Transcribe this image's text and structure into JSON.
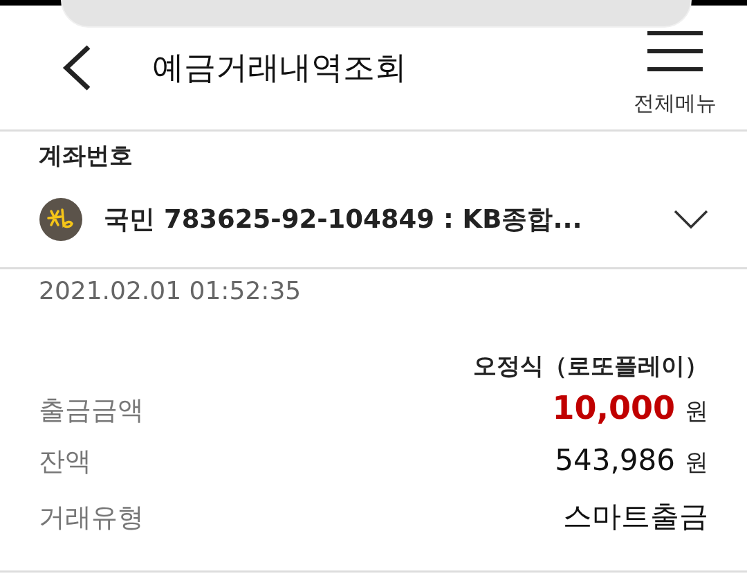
{
  "header": {
    "title": "예금거래내역조회",
    "menu_label": "전체메뉴"
  },
  "account": {
    "label": "계좌번호",
    "value": "국민 783625-92-104849 : KB종합..."
  },
  "transaction": {
    "datetime": "2021.02.01 01:52:35",
    "counterparty": "오정식（로또플레이）",
    "rows": [
      {
        "label": "출금금액",
        "value": "10,000",
        "unit": "원",
        "kind": "highlight"
      },
      {
        "label": "잔액",
        "value": "543,986",
        "unit": "원",
        "kind": "plain"
      },
      {
        "label": "거래유형",
        "value": "스마트출금",
        "kind": "text"
      }
    ]
  }
}
